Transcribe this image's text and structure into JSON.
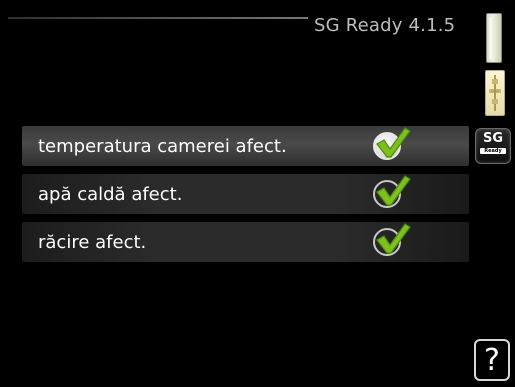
{
  "header": {
    "title": "SG Ready 4.1.5"
  },
  "side": {
    "scroll_icon": "scroll-position-icon",
    "tree_icon": "menu-tree-icon",
    "sg_icon": {
      "label": "SG",
      "sub_label": "Ready"
    },
    "help_label": "?"
  },
  "menu": {
    "items": [
      {
        "label": "temperatura camerei afect.",
        "checked": true,
        "selected": true
      },
      {
        "label": "apă caldă afect.",
        "checked": true,
        "selected": false
      },
      {
        "label": "răcire afect.",
        "checked": true,
        "selected": false
      }
    ]
  },
  "colors": {
    "check_green": "#7cc01e",
    "background": "#000000",
    "text": "#ffffff"
  }
}
